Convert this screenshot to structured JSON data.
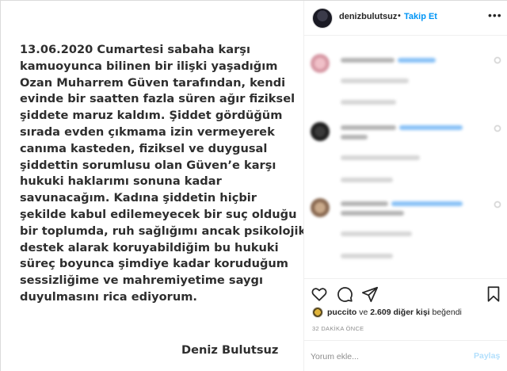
{
  "image": {
    "statement_lines": [
      "13.06.2020 Cumartesi sabaha karşı",
      "kamuoyunca bilinen bir ilişki yaşadığım",
      "Ozan Muharrem Güven tarafından, kendi",
      "evinde bir saatten fazla süren ağır fiziksel",
      "şiddete maruz kaldım. Şiddet gördüğüm",
      "sırada evden çıkmama izin vermeyerek",
      "canıma kasteden, fiziksel ve duygusal",
      "şiddettin sorumlusu olan Güven’e karşı",
      "hukuki haklarımı sonuna kadar",
      "savunacağım. Kadına şiddetin hiçbir",
      "şekilde kabul edilemeyecek bir suç olduğu",
      "bir toplumda, ruh sağlığımı ancak psikolojik",
      "destek alarak koruyabildiğim bu hukuki",
      "süreç boyunca şimdiye kadar koruduğum",
      "sessizliğime ve mahremiyetime saygı",
      "duyulmasını rica ediyorum."
    ],
    "signature": "Deniz Bulutsuz"
  },
  "header": {
    "username": "denizbulutsuz",
    "separator": "•",
    "follow_label": "Takip Et",
    "more_label": "•••"
  },
  "likes": {
    "liker": "puccito",
    "connector": " ve ",
    "others": "2.609 diğer kişi",
    "suffix": " beğendi"
  },
  "time_ago": "32 DAKİKA ÖNCE",
  "comment": {
    "placeholder": "Yorum ekle...",
    "post_label": "Paylaş"
  },
  "colors": {
    "accent": "#0095f6",
    "post_disabled": "#b2dffc",
    "secondary_text": "#8e8e8e"
  },
  "icons": [
    "heart-icon",
    "comment-icon",
    "share-icon",
    "bookmark-icon",
    "more-icon"
  ]
}
